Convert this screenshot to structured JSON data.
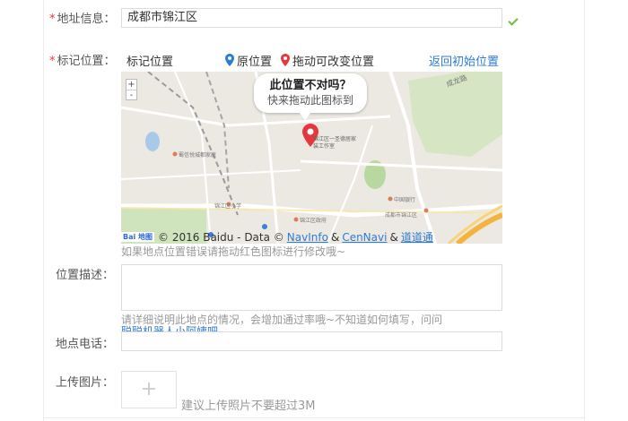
{
  "address": {
    "label": "地址信息：",
    "required_mark": "*",
    "value": "成都市锦江区"
  },
  "map_position": {
    "label": "标记位置：",
    "required_mark": "*",
    "title": "标记位置",
    "legend_original": "原位置",
    "legend_draggable": "拖动可改变位置",
    "reset_link": "返回初始位置",
    "colors": {
      "original_pin": "#2e7bd4",
      "drag_pin": "#e4393c",
      "link": "#2e7bd4"
    }
  },
  "map": {
    "bubble_question": "此位置不对吗？",
    "bubble_detail": "快来拖动此图标到",
    "pin_label": "锦江区一圣德居家装工作室",
    "road_label": "成龙路",
    "zoom_in": "+",
    "zoom_out": "-",
    "poi_1": "蜀信悦城都家庭",
    "poi_2": "锦江区小学",
    "poi_3": "锦江区政府",
    "poi_4": "中国银行",
    "poi_5": "成都市锦江区",
    "copyright_prefix": "© 2016 Baidu - Data ©",
    "copyright_link1": "NavInfo",
    "copyright_amp": "&",
    "copyright_link2": "CenNavi",
    "copyright_amp2": "&",
    "copyright_link3": "道道通",
    "logo_main": "Bai",
    "logo_sub": "地图"
  },
  "map_hint": "如果地点位置错误请拖动红色图标进行修改哦~",
  "description": {
    "label": "位置描述：",
    "hint_line1": "请详细说明此地点的情况，会增加通过率哦~不知道如何填写，问问",
    "hint_line2": "聪聪机器人小阿姨吧"
  },
  "phone": {
    "label": "地点电话：",
    "value": ""
  },
  "upload": {
    "label": "上传图片：",
    "plus": "+",
    "hint": "建议上传照片不要超过3M"
  }
}
